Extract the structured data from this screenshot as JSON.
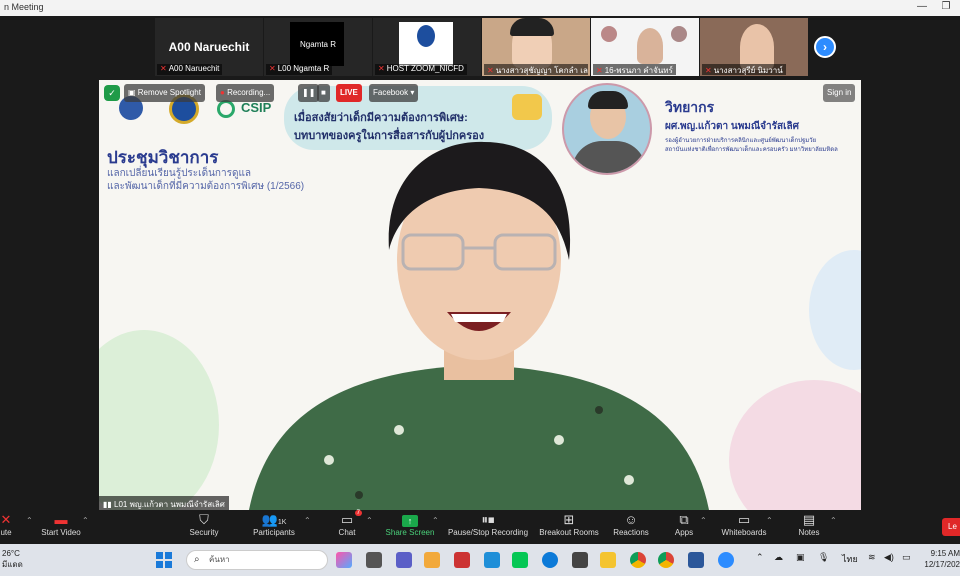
{
  "window": {
    "title": "n Meeting"
  },
  "gallery": {
    "tiles": [
      {
        "center_text": "A00 Naruechit",
        "label": "A00 Naruechit"
      },
      {
        "center_text": "Ngamta R",
        "label": "L00 Ngamta R"
      },
      {
        "center_text": "",
        "label": "HOST ZOOM_NICFD"
      },
      {
        "center_text": "",
        "label": "นางสาวสุชัญญา โคกลำ เล..."
      },
      {
        "center_text": "",
        "label": "16-พรนภา คำจันทร์"
      },
      {
        "center_text": "",
        "label": "นางสาวสุรีย์ นิมวาน์"
      }
    ],
    "next_glyph": "›"
  },
  "stage": {
    "overlay": {
      "remove_spotlight": "Remove Spotlight",
      "recording": "Recording...",
      "live": "LIVE",
      "facebook": "Facebook",
      "sign_in": "Sign in"
    },
    "slide": {
      "banner_line1": "เมื่อสงสัยว่าเด็กมีความต้องการพิเศษ:",
      "banner_line2": "บทบาทของครูในการสื่อสารกับผู้ปกครอง",
      "logo_csip": "CSIP",
      "heading": "ประชุมวิชาการ",
      "sub_line1": "แลกเปลี่ยนเรียนรู้ประเด็นการดูแล",
      "sub_line2": "และพัฒนาเด็กที่มีความต้องการพิเศษ (1/2566)",
      "speaker_title": "วิทยากร",
      "speaker_name": "ผศ.พญ.แก้วตา นพมณีจำรัสเลิศ",
      "speaker_aff1": "รองผู้อำนวยการฝ่ายบริการคลินิกและศูนย์พัฒนาเด็กปฐมวัย",
      "speaker_aff2": "สถาบันแห่งชาติเพื่อการพัฒนาเด็กและครอบครัว มหาวิทยาลัยมหิดล"
    },
    "video_name": "L01 พญ.แก้วตา นพมณีจำรัสเลิศ"
  },
  "toolbar": {
    "mute": "ute",
    "start_video": "Start Video",
    "security": "Security",
    "participants": "Participants",
    "participants_count": "1K",
    "chat": "Chat",
    "chat_badge": "7",
    "share_screen": "Share Screen",
    "pause_stop_recording": "Pause/Stop Recording",
    "breakout_rooms": "Breakout Rooms",
    "reactions": "Reactions",
    "apps": "Apps",
    "whiteboards": "Whiteboards",
    "notes": "Notes",
    "leave": "Le"
  },
  "taskbar": {
    "temperature": "26°C",
    "weather_text": "มีแดด",
    "search_placeholder": "ค้นหา",
    "lang": "ไทย",
    "time": "9:15 AM",
    "date": "12/17/202"
  },
  "colors": {
    "zoom_blue": "#2d8cff",
    "live_red": "#e02828",
    "share_green": "#1aa84b",
    "slide_navy": "#2a3b8f"
  }
}
